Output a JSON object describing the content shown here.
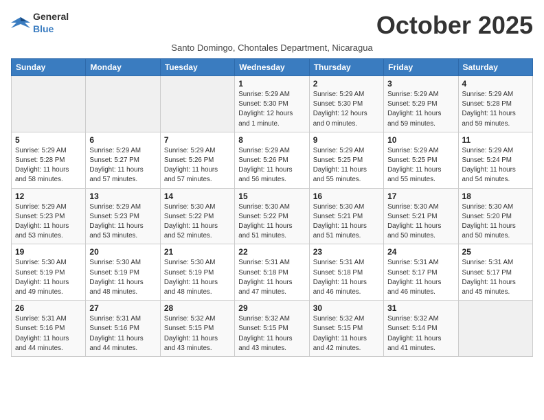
{
  "header": {
    "logo_general": "General",
    "logo_blue": "Blue",
    "month_title": "October 2025",
    "subtitle": "Santo Domingo, Chontales Department, Nicaragua"
  },
  "days_of_week": [
    "Sunday",
    "Monday",
    "Tuesday",
    "Wednesday",
    "Thursday",
    "Friday",
    "Saturday"
  ],
  "weeks": [
    [
      {
        "day": "",
        "info": ""
      },
      {
        "day": "",
        "info": ""
      },
      {
        "day": "",
        "info": ""
      },
      {
        "day": "1",
        "info": "Sunrise: 5:29 AM\nSunset: 5:30 PM\nDaylight: 12 hours\nand 1 minute."
      },
      {
        "day": "2",
        "info": "Sunrise: 5:29 AM\nSunset: 5:30 PM\nDaylight: 12 hours\nand 0 minutes."
      },
      {
        "day": "3",
        "info": "Sunrise: 5:29 AM\nSunset: 5:29 PM\nDaylight: 11 hours\nand 59 minutes."
      },
      {
        "day": "4",
        "info": "Sunrise: 5:29 AM\nSunset: 5:28 PM\nDaylight: 11 hours\nand 59 minutes."
      }
    ],
    [
      {
        "day": "5",
        "info": "Sunrise: 5:29 AM\nSunset: 5:28 PM\nDaylight: 11 hours\nand 58 minutes."
      },
      {
        "day": "6",
        "info": "Sunrise: 5:29 AM\nSunset: 5:27 PM\nDaylight: 11 hours\nand 57 minutes."
      },
      {
        "day": "7",
        "info": "Sunrise: 5:29 AM\nSunset: 5:26 PM\nDaylight: 11 hours\nand 57 minutes."
      },
      {
        "day": "8",
        "info": "Sunrise: 5:29 AM\nSunset: 5:26 PM\nDaylight: 11 hours\nand 56 minutes."
      },
      {
        "day": "9",
        "info": "Sunrise: 5:29 AM\nSunset: 5:25 PM\nDaylight: 11 hours\nand 55 minutes."
      },
      {
        "day": "10",
        "info": "Sunrise: 5:29 AM\nSunset: 5:25 PM\nDaylight: 11 hours\nand 55 minutes."
      },
      {
        "day": "11",
        "info": "Sunrise: 5:29 AM\nSunset: 5:24 PM\nDaylight: 11 hours\nand 54 minutes."
      }
    ],
    [
      {
        "day": "12",
        "info": "Sunrise: 5:29 AM\nSunset: 5:23 PM\nDaylight: 11 hours\nand 53 minutes."
      },
      {
        "day": "13",
        "info": "Sunrise: 5:29 AM\nSunset: 5:23 PM\nDaylight: 11 hours\nand 53 minutes."
      },
      {
        "day": "14",
        "info": "Sunrise: 5:30 AM\nSunset: 5:22 PM\nDaylight: 11 hours\nand 52 minutes."
      },
      {
        "day": "15",
        "info": "Sunrise: 5:30 AM\nSunset: 5:22 PM\nDaylight: 11 hours\nand 51 minutes."
      },
      {
        "day": "16",
        "info": "Sunrise: 5:30 AM\nSunset: 5:21 PM\nDaylight: 11 hours\nand 51 minutes."
      },
      {
        "day": "17",
        "info": "Sunrise: 5:30 AM\nSunset: 5:21 PM\nDaylight: 11 hours\nand 50 minutes."
      },
      {
        "day": "18",
        "info": "Sunrise: 5:30 AM\nSunset: 5:20 PM\nDaylight: 11 hours\nand 50 minutes."
      }
    ],
    [
      {
        "day": "19",
        "info": "Sunrise: 5:30 AM\nSunset: 5:19 PM\nDaylight: 11 hours\nand 49 minutes."
      },
      {
        "day": "20",
        "info": "Sunrise: 5:30 AM\nSunset: 5:19 PM\nDaylight: 11 hours\nand 48 minutes."
      },
      {
        "day": "21",
        "info": "Sunrise: 5:30 AM\nSunset: 5:19 PM\nDaylight: 11 hours\nand 48 minutes."
      },
      {
        "day": "22",
        "info": "Sunrise: 5:31 AM\nSunset: 5:18 PM\nDaylight: 11 hours\nand 47 minutes."
      },
      {
        "day": "23",
        "info": "Sunrise: 5:31 AM\nSunset: 5:18 PM\nDaylight: 11 hours\nand 46 minutes."
      },
      {
        "day": "24",
        "info": "Sunrise: 5:31 AM\nSunset: 5:17 PM\nDaylight: 11 hours\nand 46 minutes."
      },
      {
        "day": "25",
        "info": "Sunrise: 5:31 AM\nSunset: 5:17 PM\nDaylight: 11 hours\nand 45 minutes."
      }
    ],
    [
      {
        "day": "26",
        "info": "Sunrise: 5:31 AM\nSunset: 5:16 PM\nDaylight: 11 hours\nand 44 minutes."
      },
      {
        "day": "27",
        "info": "Sunrise: 5:31 AM\nSunset: 5:16 PM\nDaylight: 11 hours\nand 44 minutes."
      },
      {
        "day": "28",
        "info": "Sunrise: 5:32 AM\nSunset: 5:15 PM\nDaylight: 11 hours\nand 43 minutes."
      },
      {
        "day": "29",
        "info": "Sunrise: 5:32 AM\nSunset: 5:15 PM\nDaylight: 11 hours\nand 43 minutes."
      },
      {
        "day": "30",
        "info": "Sunrise: 5:32 AM\nSunset: 5:15 PM\nDaylight: 11 hours\nand 42 minutes."
      },
      {
        "day": "31",
        "info": "Sunrise: 5:32 AM\nSunset: 5:14 PM\nDaylight: 11 hours\nand 41 minutes."
      },
      {
        "day": "",
        "info": ""
      }
    ]
  ]
}
